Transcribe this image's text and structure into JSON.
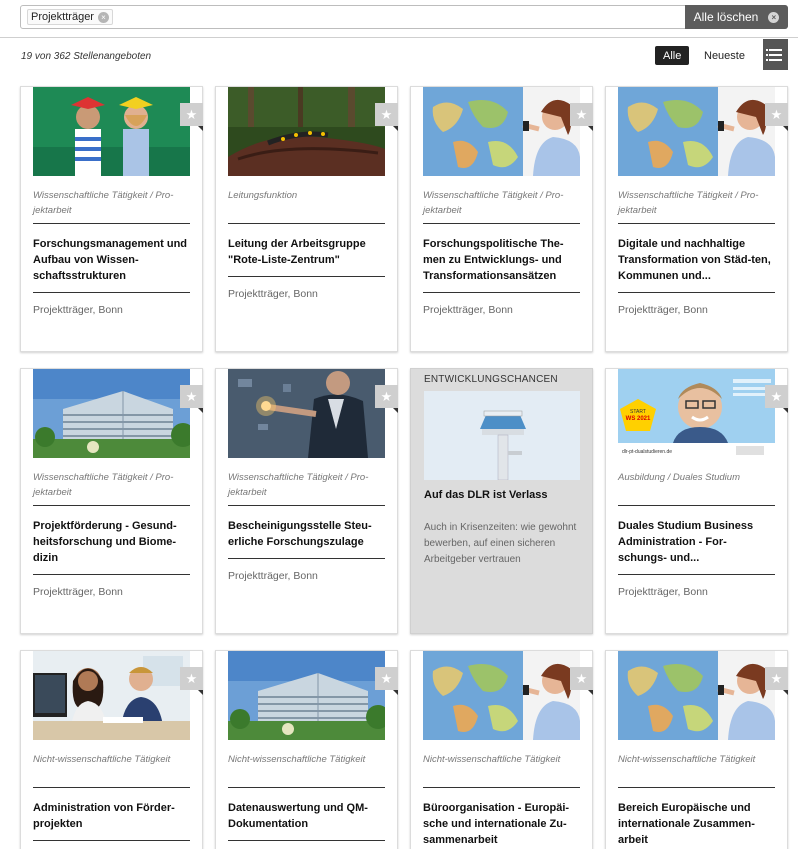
{
  "filter": {
    "chip_label": "Projektträger",
    "chip_remove": "×",
    "clear_all_label": "Alle löschen",
    "clear_all_icon": "×"
  },
  "results": {
    "count_text": "19 von 362 Stellenangeboten",
    "sort_all": "Alle",
    "sort_newest": "Neueste"
  },
  "colors": {
    "dark_button": "#5c5c5c",
    "bookmark": "#cfcfcf",
    "promo_bg": "#dcdcdc"
  },
  "cards": [
    {
      "image": "children-with-books",
      "category": "Wissenschaftliche Tätigkeit / Pro-jektarbeit",
      "title": "Forschungsmanagement und Aufbau von Wissen-schaftsstrukturen",
      "location": "Projektträger, Bonn"
    },
    {
      "image": "salamander-on-log",
      "category": "Leitungsfunktion",
      "title": "Leitung der Arbeitsgruppe \"Rote-Liste-Zentrum\"",
      "location": "Projektträger, Bonn"
    },
    {
      "image": "woman-at-world-map",
      "category": "Wissenschaftliche Tätigkeit / Pro-jektarbeit",
      "title": "Forschungspolitische The-men zu Entwicklungs- und Transformationsansätzen",
      "location": "Projektträger, Bonn"
    },
    {
      "image": "woman-at-world-map",
      "category": "Wissenschaftliche Tätigkeit / Pro-jektarbeit",
      "title": "Digitale und nachhaltige Transformation von Städ-ten, Kommunen und...",
      "location": "Projektträger, Bonn"
    },
    {
      "image": "glass-office-building",
      "category": "Wissenschaftliche Tätigkeit / Pro-jektarbeit",
      "title": "Projektförderung - Gesund-heitsforschung und Biome-dizin",
      "location": "Projektträger, Bonn"
    },
    {
      "image": "businessman-touchscreen",
      "category": "Wissenschaftliche Tätigkeit / Pro-jektarbeit",
      "title": "Bescheinigungsstelle Steu-erliche Forschungszulage",
      "location": "Projektträger, Bonn"
    },
    {
      "image": "smiling-man-with-glasses",
      "category": "Ausbildung / Duales Studium",
      "title": "Duales Studium Business Administration - For-schungs- und...",
      "location": "Projektträger, Bonn"
    },
    {
      "image": "two-colleagues-at-desk",
      "category": "Nicht-wissenschaftliche Tätigkeit",
      "title": "Administration von Förder-projekten",
      "location": ""
    },
    {
      "image": "glass-office-building",
      "category": "Nicht-wissenschaftliche Tätigkeit",
      "title": "Datenauswertung und QM-Dokumentation",
      "location": ""
    },
    {
      "image": "woman-at-world-map",
      "category": "Nicht-wissenschaftliche Tätigkeit",
      "title": "Büroorganisation - Europäi-sche und internationale Zu-sammenarbeit",
      "location": ""
    },
    {
      "image": "woman-at-world-map",
      "category": "Nicht-wissenschaftliche Tätigkeit",
      "title": "Bereich Europäische und internationale Zusammen-arbeit",
      "location": ""
    }
  ],
  "promo": {
    "heading": "ENTWICKLUNGSCHANCEN",
    "image": "control-tower",
    "title": "Auf das DLR ist Verlass",
    "text": "Auch in Krisenzeiten: wie gewohnt bewerben, auf einen sicheren Arbeitgeber vertrauen"
  },
  "poster": {
    "badge_line1": "START",
    "badge_line2": "WS 2021",
    "url": "dlr-pt-dualstudieren.de"
  },
  "bookmark_icon": "★"
}
